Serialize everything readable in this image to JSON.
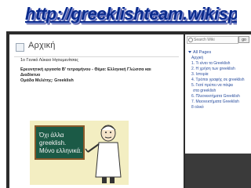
{
  "banner": {
    "url_text": "http://greeklishteam.wikispaces.com"
  },
  "page": {
    "title": "Αρχική",
    "lines": [
      "1ο Γενικό Λύκειο Ηγουμενίτσας",
      "Ερευνητική εργασία Β' τετραμήνου - Θέμα: Ελληνική Γλώσσα και",
      "Διαδίκτυο",
      "Ομάδα Μελέτης: Greeklish"
    ]
  },
  "graphic": {
    "chalkboard": [
      "Όχι άλλα",
      "greeklish.",
      "Μόνο ελληνικά."
    ]
  },
  "sidebar": {
    "search_placeholder": "Search Wiki",
    "go_label": "go",
    "all_pages_label": "All Pages",
    "items": [
      "Αρχική",
      "1. Τι είναι τα Greeklish",
      "2. Η χρήση των greeklish",
      "3. Ιστορία",
      "4. Τρόποι γραφής σε greeklish",
      "5. Γιατί πρέπει να πάψει",
      "στα greeklish",
      "6. Πλεονεκτήματα Greeklish",
      "7. Μειονεκτήματα Greeklish",
      "8 ολικό"
    ]
  },
  "colors": {
    "banner_text": "#0a2a8c",
    "link": "#2a4e9e",
    "chalkboard": "#1b5a46",
    "graphic_bg": "#f3eec2"
  }
}
